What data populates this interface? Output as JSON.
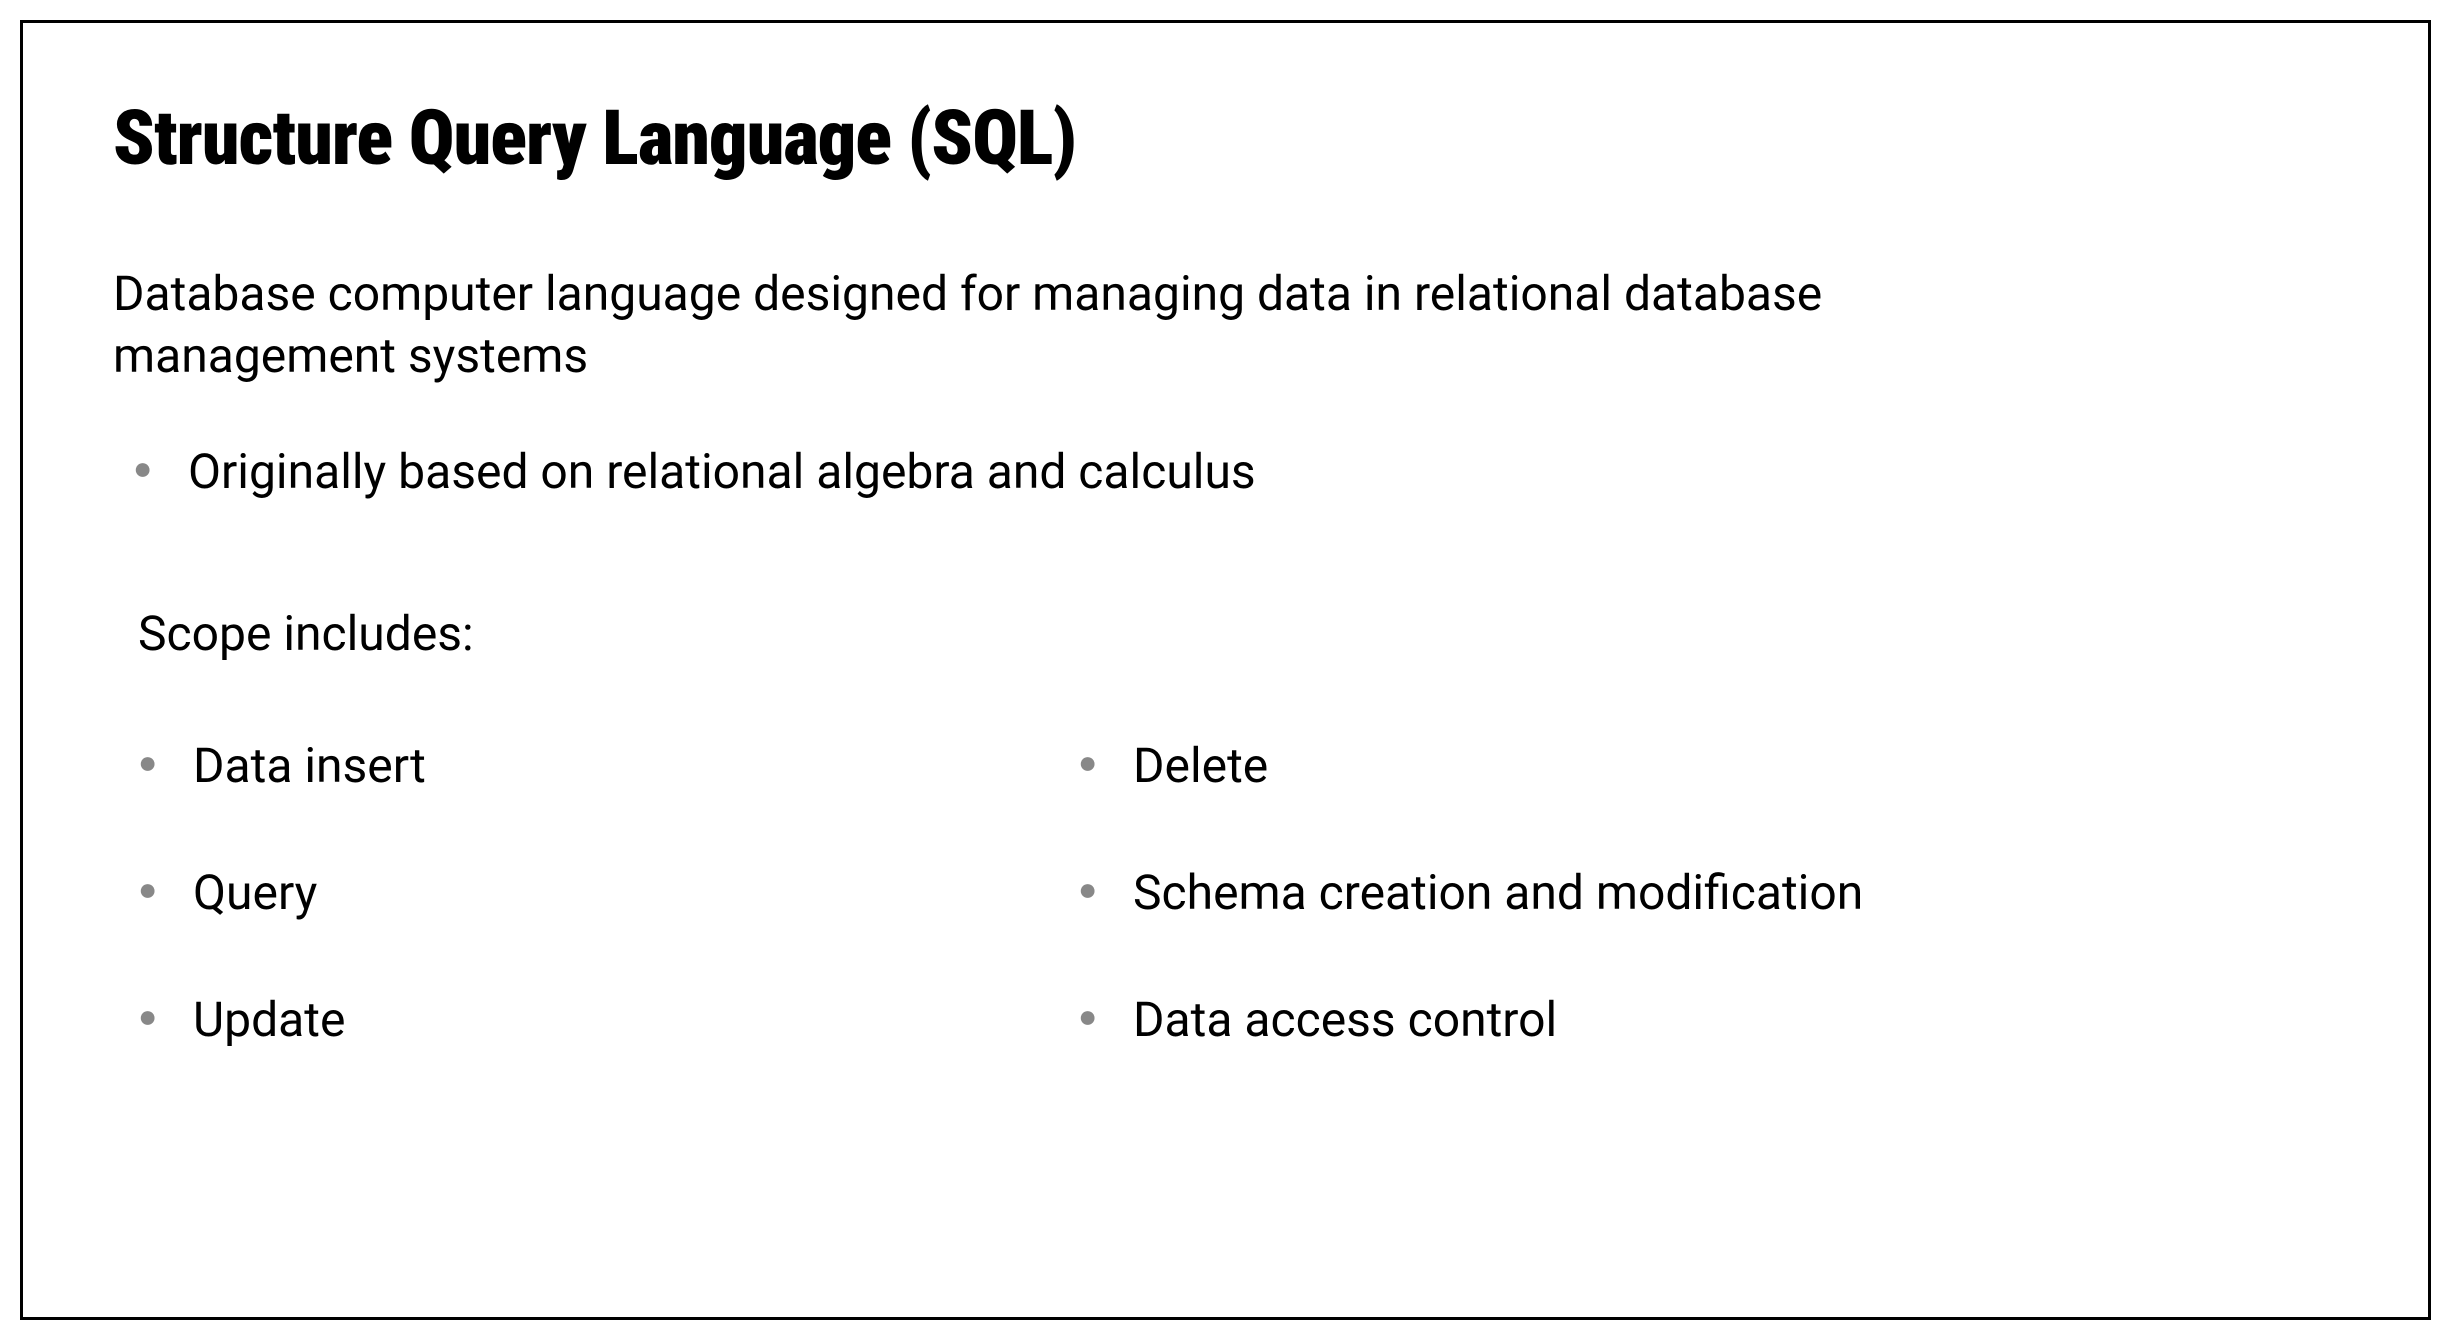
{
  "slide": {
    "title": "Structure Query Language (SQL)",
    "intro": "Database computer language designed for managing data in relational database management systems",
    "intro_bullets": [
      "Originally based on relational algebra and calculus"
    ],
    "scope": {
      "heading": "Scope includes:",
      "left_items": [
        "Data insert",
        "Query",
        "Update"
      ],
      "right_items": [
        "Delete",
        "Schema creation and modification",
        "Data access control"
      ]
    }
  }
}
